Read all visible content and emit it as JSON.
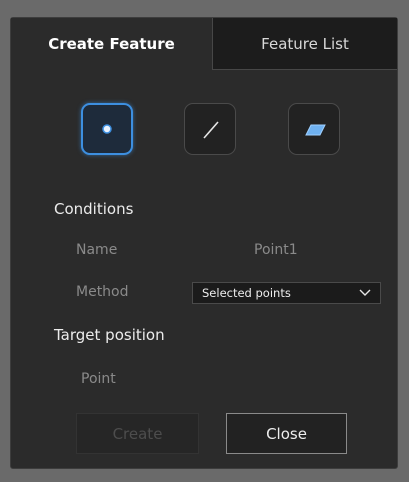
{
  "tabs": {
    "create_feature": "Create Feature",
    "feature_list": "Feature List"
  },
  "feature_types": [
    {
      "name": "point",
      "icon": "point-icon",
      "selected": true
    },
    {
      "name": "line",
      "icon": "line-icon",
      "selected": false
    },
    {
      "name": "plane",
      "icon": "plane-icon",
      "selected": false
    }
  ],
  "conditions": {
    "title": "Conditions",
    "name_label": "Name",
    "name_value": "Point1",
    "method_label": "Method",
    "method_value": "Selected points"
  },
  "target": {
    "title": "Target position",
    "point_label": "Point"
  },
  "buttons": {
    "create": "Create",
    "close": "Close"
  },
  "colors": {
    "accent": "#3d8fe0",
    "panel_bg": "#2b2b2b"
  }
}
